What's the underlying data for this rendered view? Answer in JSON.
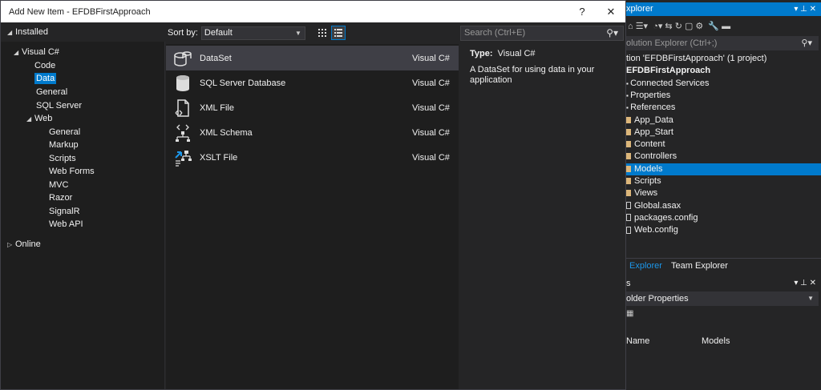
{
  "dialog": {
    "title": "Add New Item - EFDBFirstApproach",
    "help": "?",
    "close": "✕"
  },
  "tree": {
    "installed": "Installed",
    "visual_csharp": "Visual C#",
    "items": [
      "Code",
      "Data",
      "General",
      "SQL Server"
    ],
    "web": "Web",
    "web_items": [
      "General",
      "Markup",
      "Scripts",
      "Web Forms",
      "MVC",
      "Razor",
      "SignalR",
      "Web API"
    ],
    "online": "Online"
  },
  "sort": {
    "label": "Sort by:",
    "value": "Default"
  },
  "templates": [
    {
      "name": "DataSet",
      "lang": "Visual C#",
      "icon": "dataset-icon"
    },
    {
      "name": "SQL Server Database",
      "lang": "Visual C#",
      "icon": "database-icon"
    },
    {
      "name": "XML File",
      "lang": "Visual C#",
      "icon": "xml-file-icon"
    },
    {
      "name": "XML Schema",
      "lang": "Visual C#",
      "icon": "xml-schema-icon"
    },
    {
      "name": "XSLT File",
      "lang": "Visual C#",
      "icon": "xslt-file-icon"
    }
  ],
  "search": {
    "placeholder": "Search (Ctrl+E)"
  },
  "info": {
    "type_label": "Type:",
    "type_value": "Visual C#",
    "description": "A DataSet for using data in your application"
  },
  "solution_explorer": {
    "title": "xplorer",
    "search": "olution Explorer (Ctrl+;)",
    "rows": [
      {
        "text": "tion 'EFDBFirstApproach' (1 project)",
        "kind": "plain",
        "bold": false
      },
      {
        "text": "EFDBFirstApproach",
        "kind": "plain",
        "bold": true
      },
      {
        "text": "Connected Services",
        "kind": "plain",
        "bold": false
      },
      {
        "text": "Properties",
        "kind": "plain",
        "bold": false
      },
      {
        "text": "References",
        "kind": "plain",
        "bold": false
      },
      {
        "text": "App_Data",
        "kind": "folder",
        "bold": false
      },
      {
        "text": "App_Start",
        "kind": "folder",
        "bold": false
      },
      {
        "text": "Content",
        "kind": "folder",
        "bold": false
      },
      {
        "text": "Controllers",
        "kind": "folder",
        "bold": false
      },
      {
        "text": "Models",
        "kind": "folder",
        "bold": false,
        "selected": true
      },
      {
        "text": "Scripts",
        "kind": "folder",
        "bold": false
      },
      {
        "text": "Views",
        "kind": "folder",
        "bold": false
      },
      {
        "text": "Global.asax",
        "kind": "file",
        "bold": false
      },
      {
        "text": "packages.config",
        "kind": "file",
        "bold": false
      },
      {
        "text": "Web.config",
        "kind": "file",
        "bold": false
      }
    ],
    "tabs": [
      "Explorer",
      "Team Explorer"
    ],
    "props_title": "s",
    "props_sub": "older Properties",
    "props_key": "Name",
    "props_value": "Models"
  },
  "colors": {
    "accent": "#007acc",
    "bg": "#1e1e1e",
    "panel": "#252526"
  }
}
